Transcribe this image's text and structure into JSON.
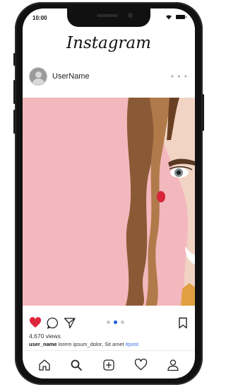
{
  "status_bar": {
    "time": "10:00"
  },
  "header": {
    "app_title": "Instagram"
  },
  "post": {
    "username": "UserName",
    "more_label": "• • •",
    "liked": true,
    "carousel": {
      "count": 3,
      "active_index": 1
    },
    "views": "4,670 views",
    "caption": {
      "user": "user_name",
      "text": "lorem ipsum_dolor, Sit amet",
      "hashtag": "#post"
    }
  },
  "colors": {
    "like": "#e0263c",
    "hashtag": "#3a6ee8",
    "carousel_active": "#1e5bd8",
    "photo_background": "#f3b8bd"
  },
  "icons": {
    "actions": [
      "heart-icon",
      "comment-icon",
      "share-icon"
    ],
    "save": "bookmark-icon",
    "tabs": [
      "home-icon",
      "search-icon",
      "add-icon",
      "activity-icon",
      "profile-icon"
    ]
  }
}
